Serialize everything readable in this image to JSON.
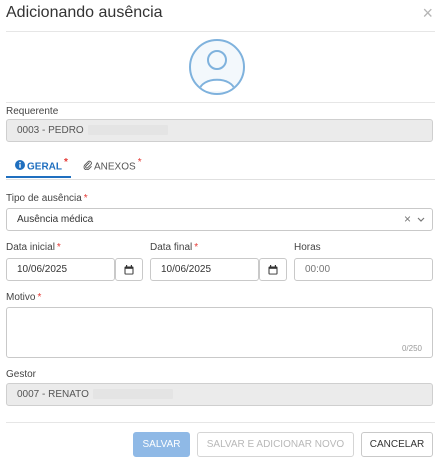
{
  "dialog": {
    "title": "Adicionando ausência",
    "close_glyph": "×"
  },
  "requerente": {
    "label": "Requerente",
    "value": "0003 - PEDRO"
  },
  "tabs": [
    {
      "label": "GERAL",
      "required_mark": "*",
      "icon": "info-icon"
    },
    {
      "label": "ANEXOS",
      "required_mark": "*",
      "icon": "paperclip-icon"
    }
  ],
  "tipo_ausencia": {
    "label": "Tipo de ausência",
    "required_mark": "*",
    "value": "Ausência médica",
    "clear_glyph": "×",
    "chevron_glyph": "⌄"
  },
  "data_inicial": {
    "label": "Data inicial",
    "required_mark": "*",
    "value": "10/06/2025"
  },
  "data_final": {
    "label": "Data final",
    "required_mark": "*",
    "value": "10/06/2025"
  },
  "horas": {
    "label": "Horas",
    "placeholder": "00:00"
  },
  "motivo": {
    "label": "Motivo",
    "required_mark": "*",
    "value": "",
    "counter": "0/250"
  },
  "gestor": {
    "label": "Gestor",
    "value": "0007 - RENATO"
  },
  "footer": {
    "save_label": "SALVAR",
    "save_add_label": "SALVAR E ADICIONAR NOVO",
    "cancel_label": "CANCELAR"
  },
  "colors": {
    "accent": "#1f6fbf",
    "required": "#e53935",
    "save_disabled": "#8fb9e6"
  }
}
